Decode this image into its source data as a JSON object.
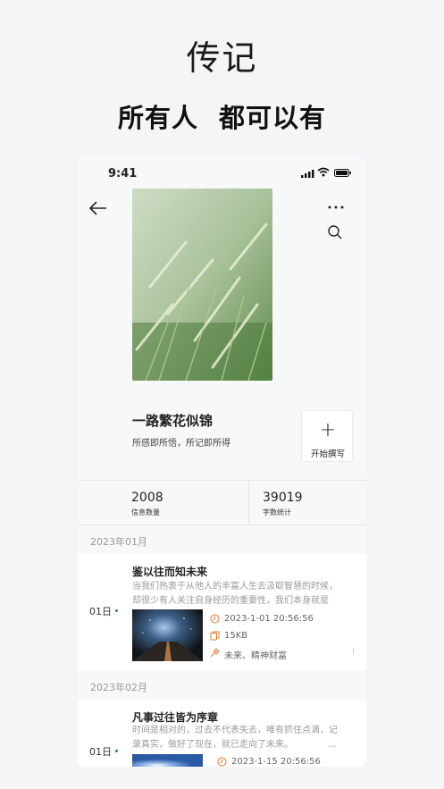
{
  "hero": {
    "title": "传记",
    "subtitle": "所有人  都可以有"
  },
  "status_bar": {
    "time": "9:41"
  },
  "book": {
    "title": "一路繁花似锦",
    "description": "所感即所悟，所记即所得",
    "write_button": {
      "icon": "+",
      "label": "开始撰写"
    }
  },
  "stats": [
    {
      "value": "2008",
      "label": "信息数量"
    },
    {
      "value": "39019",
      "label": "字数统计"
    }
  ],
  "entries": [
    {
      "month": "2023年01月",
      "day": "01日",
      "title": "鉴以往而知未来",
      "excerpt": "当我们热衷于从他人的丰富人生去汲取智慧的时候，却很少有人关注自身经历的重要性，我们本身就是自...",
      "datetime": "2023-1-01 20:56:56",
      "size": "15KB",
      "tags": "未来、精神财富"
    },
    {
      "month": "2023年02月",
      "day": "01日",
      "title": "凡事过往皆为序章",
      "excerpt": "时间是相对的，过去不代表失去，唯有抓住点滴，记录真实，做好了现在，就已走向了未来。",
      "excerpt_ellipsis": "...",
      "datetime": "2023-1-15 20:56:56"
    }
  ],
  "icons": [
    "back-arrow-icon",
    "more-icon",
    "search-icon",
    "signal-icon",
    "wifi-icon",
    "battery-icon",
    "plus-icon",
    "clock-icon",
    "file-icon",
    "tag-icon"
  ],
  "colors": {
    "accent_orange": "#d9782f",
    "accent_green": "#2f7d6d",
    "background": "#f3f5f7"
  }
}
